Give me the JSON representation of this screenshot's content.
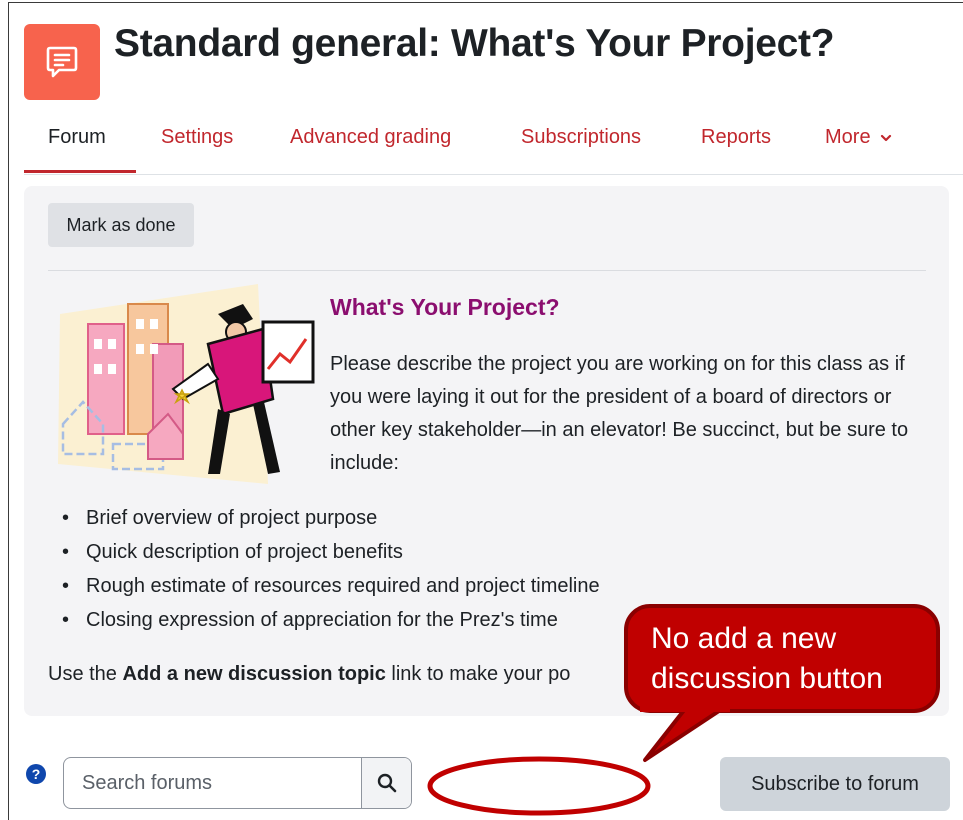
{
  "page": {
    "title": "Standard general: What's Your Project?",
    "icon": "forum-chat-icon",
    "icon_color": "#f7634d"
  },
  "tabs": [
    {
      "label": "Forum",
      "active": true
    },
    {
      "label": "Settings",
      "active": false
    },
    {
      "label": "Advanced grading",
      "active": false
    },
    {
      "label": "Subscriptions",
      "active": false
    },
    {
      "label": "Reports",
      "active": false
    },
    {
      "label": "More",
      "active": false,
      "icon": "chevron-down-icon"
    }
  ],
  "activity": {
    "mark_done_label": "Mark as done"
  },
  "intro": {
    "heading": "What's Your Project?",
    "heading_color": "#8b0e6f",
    "paragraph": "Please describe the project you are working on for this class as if you were laying it out for the president of a board of directors or other key stakeholder—in an elevator! Be succinct, but be sure to include:",
    "bullets": [
      "Brief overview of project purpose",
      "Quick description of project benefits",
      "Rough estimate of resources required and project timeline",
      "Closing expression of appreciation for the Prez's time"
    ],
    "use_prefix": "Use the ",
    "use_bold": "Add a new discussion topic",
    "use_suffix": " link to make your po"
  },
  "search": {
    "placeholder": "Search forums",
    "value": "",
    "button_icon": "search-icon"
  },
  "subscribe_label": "Subscribe to forum",
  "help_icon": "question-circle-icon",
  "callout": {
    "line1": "No add a new",
    "line2": "discussion button",
    "fill_color": "#c00000"
  },
  "colors": {
    "accent": "#c1272d",
    "intro_bg": "#f4f4f6"
  }
}
